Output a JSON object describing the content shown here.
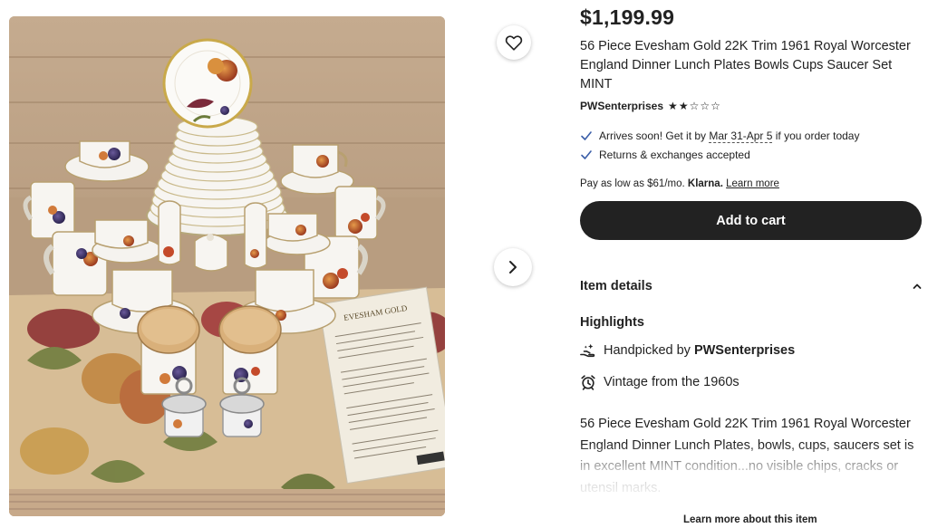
{
  "product": {
    "price": "$1,199.99",
    "title": "56 Piece Evesham Gold 22K Trim 1961 Royal Worcester England Dinner Lunch Plates Bowls Cups Saucer Set MINT",
    "shop_name": "PWSenterprises",
    "rating": 2,
    "rating_max": 5
  },
  "shipping": {
    "arrival_prefix": "Arrives soon! Get it by",
    "arrival_dates": "Mar 31-Apr 5",
    "arrival_suffix": "if you order today",
    "returns": "Returns & exchanges accepted"
  },
  "payment": {
    "prefix": "Pay as low as $61/mo.",
    "provider": "Klarna.",
    "learn_more": "Learn more"
  },
  "actions": {
    "add_to_cart": "Add to cart",
    "favorite_icon": "heart-icon",
    "next_icon": "chevron-right-icon"
  },
  "details": {
    "section_label": "Item details",
    "highlights_label": "Highlights",
    "handpicked_prefix": "Handpicked by",
    "handpicked_shop": "PWSenterprises",
    "vintage": "Vintage from the 1960s",
    "description": "56 Piece Evesham Gold 22K Trim 1961 Royal Worcester England Dinner Lunch Plates, bowls, cups, saucers set is in excellent MINT condition...no visible chips, cracks or utensil marks.",
    "learn_more_item": "Learn more about this item"
  },
  "photo": {
    "leaflet_heading": "EVESHAM GOLD"
  }
}
